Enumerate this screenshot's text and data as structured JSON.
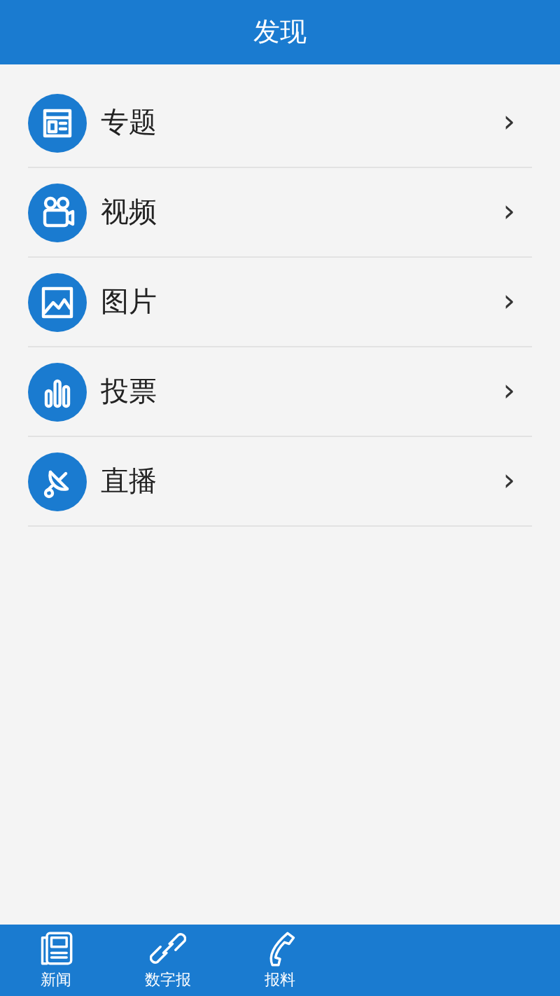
{
  "header": {
    "title": "发现"
  },
  "items": [
    {
      "kind": "topic",
      "label": "专题",
      "chevron": "›"
    },
    {
      "kind": "video",
      "label": "视频",
      "chevron": "›"
    },
    {
      "kind": "picture",
      "label": "图片",
      "chevron": "›"
    },
    {
      "kind": "vote",
      "label": "投票",
      "chevron": "›"
    },
    {
      "kind": "live",
      "label": "直播",
      "chevron": "›"
    }
  ],
  "tab_bar": [
    {
      "kind": "news",
      "label": "新闻",
      "selected": false
    },
    {
      "kind": "link",
      "label": "数字报",
      "selected": false
    },
    {
      "kind": "phone",
      "label": "报料",
      "selected": false
    }
  ]
}
